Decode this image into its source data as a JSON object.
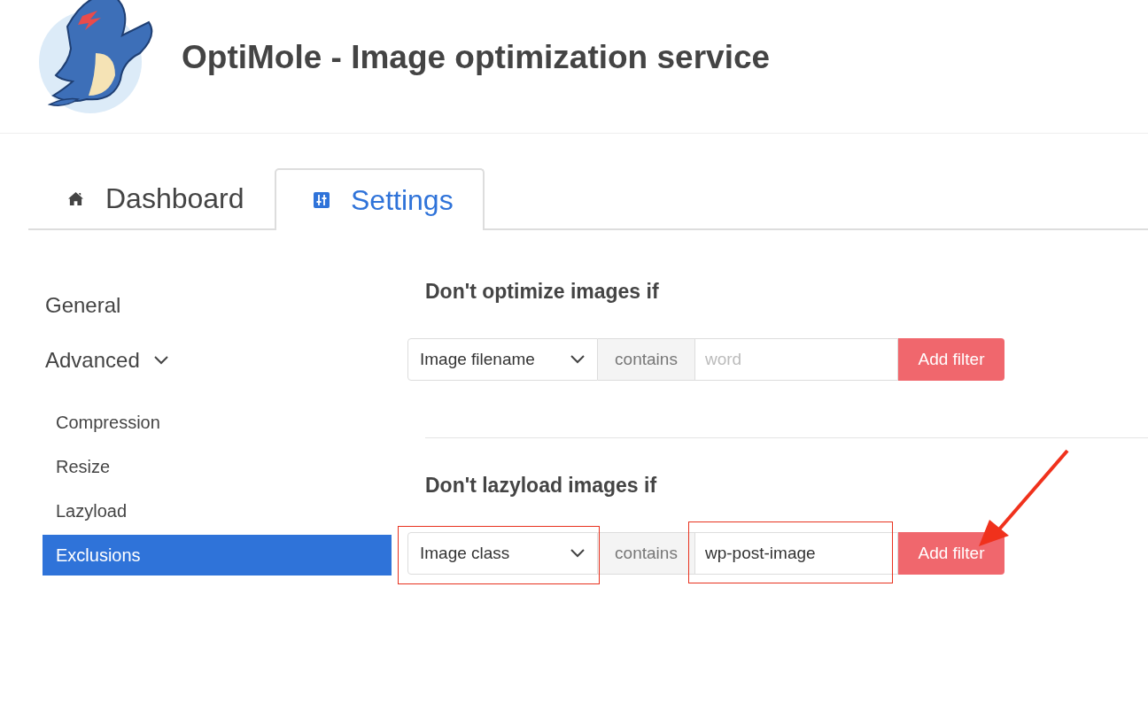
{
  "header": {
    "title": "OptiMole - Image optimization service"
  },
  "tabs": [
    {
      "label": "Dashboard",
      "selected": false
    },
    {
      "label": "Settings",
      "selected": true
    }
  ],
  "sidebar": {
    "items": [
      {
        "label": "General",
        "kind": "section",
        "selected": false
      },
      {
        "label": "Advanced",
        "kind": "group",
        "expanded": true,
        "selected": false,
        "children": [
          {
            "label": "Compression",
            "selected": false
          },
          {
            "label": "Resize",
            "selected": false
          },
          {
            "label": "Lazyload",
            "selected": false
          },
          {
            "label": "Exclusions",
            "selected": true
          }
        ]
      }
    ]
  },
  "filter_groups": [
    {
      "heading": "Don't optimize images if",
      "type": {
        "value": "Image filename",
        "highlighted": false
      },
      "operator": "contains",
      "value": {
        "placeholder": "word",
        "highlighted": false
      },
      "button": {
        "label": "Add filter",
        "pointed": false
      }
    },
    {
      "heading": "Don't lazyload images if",
      "type": {
        "value": "Image class",
        "highlighted": true
      },
      "operator": "contains",
      "value": {
        "text": "wp-post-image",
        "highlighted": true
      },
      "button": {
        "label": "Add filter",
        "pointed": true
      }
    }
  ]
}
